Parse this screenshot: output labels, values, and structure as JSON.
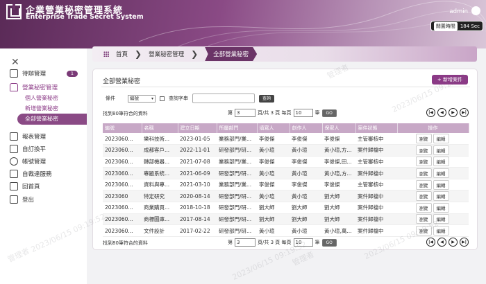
{
  "header": {
    "title_zh": "企業營業秘密管理系統",
    "title_en": "Enterprise Trade Secret System",
    "user": "admin",
    "timer_label": "閒置時間",
    "timer_value": "184 Sec"
  },
  "sidebar": {
    "items": [
      {
        "label": "待辦管理",
        "icon": "clipboard-icon"
      },
      {
        "label": "營業秘密管理",
        "icon": "lock-icon"
      },
      {
        "label": "報表管理",
        "icon": "report-icon"
      },
      {
        "label": "自訂換平",
        "icon": "calendar-icon"
      },
      {
        "label": "帳號管理",
        "icon": "gear-icon"
      },
      {
        "label": "自裁達服務",
        "icon": "service-icon"
      },
      {
        "label": "回首頁",
        "icon": "home-icon"
      },
      {
        "label": "登出",
        "icon": "logout-icon"
      }
    ],
    "badge": "1",
    "sub_items": [
      "個人營業秘密",
      "新增營業秘密",
      "全部營業秘密"
    ]
  },
  "breadcrumb": [
    "首頁",
    "營業秘密管理",
    "全部營業秘密"
  ],
  "card": {
    "title": "全部營業秘密",
    "add_button": "+ 新增案件",
    "filter": {
      "label": "條件",
      "select": "編號",
      "contains": "查詢字串",
      "search_button": "查詢"
    }
  },
  "pager_top": {
    "found": "找到80筆符合的資料",
    "page_label": "第",
    "page": "3",
    "total_text": "頁/共 3 頁 每頁",
    "per_page": "10",
    "per_suffix": "筆",
    "go": "GO"
  },
  "pager_bottom": {
    "found": "找到80筆符合的資料",
    "page_label": "第",
    "page": "3",
    "total_text": "頁/共 3 頁 每頁",
    "per_page": "10",
    "per_suffix": "筆",
    "go": "GO"
  },
  "table": {
    "columns": [
      "編號",
      "名稱",
      "建立日期",
      "所屬部門",
      "填寫人",
      "創作人",
      "保密人",
      "案件狀態",
      "操作"
    ],
    "rows": [
      [
        "2023060...",
        "樂科技術...",
        "2023-01-05",
        "業務部門/業...",
        "李俊傑",
        "李俊傑",
        "李俊傑",
        "主管審核中",
        "瀏覽",
        "編輯"
      ],
      [
        "2023060...",
        "成都客戶...",
        "2022-11-01",
        "研發部門/研...",
        "黃小瑄",
        "黃小瑄",
        "黃小瑄,方...",
        "案件歸檔中",
        "瀏覽",
        "編輯"
      ],
      [
        "2023060...",
        "轉部機器...",
        "2021-07-08",
        "業務部門/業...",
        "李俊傑",
        "李俊傑",
        "李俊傑,田...",
        "主管審核中",
        "瀏覽",
        "編輯"
      ],
      [
        "2023060...",
        "專題系統...",
        "2021-06-09",
        "研發部門/研...",
        "黃小瑄",
        "黃小瑄",
        "黃小瑄,方...",
        "案件歸檔中",
        "瀏覽",
        "編輯"
      ],
      [
        "2023060...",
        "資料與專...",
        "2021-03-10",
        "業務部門/業...",
        "李俊傑",
        "李俊傑",
        "李俊傑",
        "主管審核中",
        "瀏覽",
        "編輯"
      ],
      [
        "2023060",
        "特定研究",
        "2020-08-14",
        "研發部門/研...",
        "黃小瑄",
        "黃小瑄",
        "劉大師",
        "案件歸檔中",
        "瀏覽",
        "編輯"
      ],
      [
        "2023060...",
        "商業購買...",
        "2018-10-18",
        "研發部門/研...",
        "劉大師",
        "劉大師",
        "劉大師",
        "案件歸檔中",
        "瀏覽",
        "編輯"
      ],
      [
        "2023060...",
        "商標圖庫...",
        "2017-08-14",
        "研發部門/研...",
        "劉大師",
        "劉大師",
        "劉大師",
        "案件歸檔中",
        "瀏覽",
        "編輯"
      ],
      [
        "2023060...",
        "文件設計",
        "2017-02-22",
        "研發部門/研...",
        "黃小瑄",
        "黃小瑄",
        "黃小瑄,萬...",
        "案件歸檔中",
        "瀏覽",
        "編輯"
      ]
    ]
  },
  "watermark": "2023/06/15 09:19:52",
  "watermark_name": "管理者"
}
